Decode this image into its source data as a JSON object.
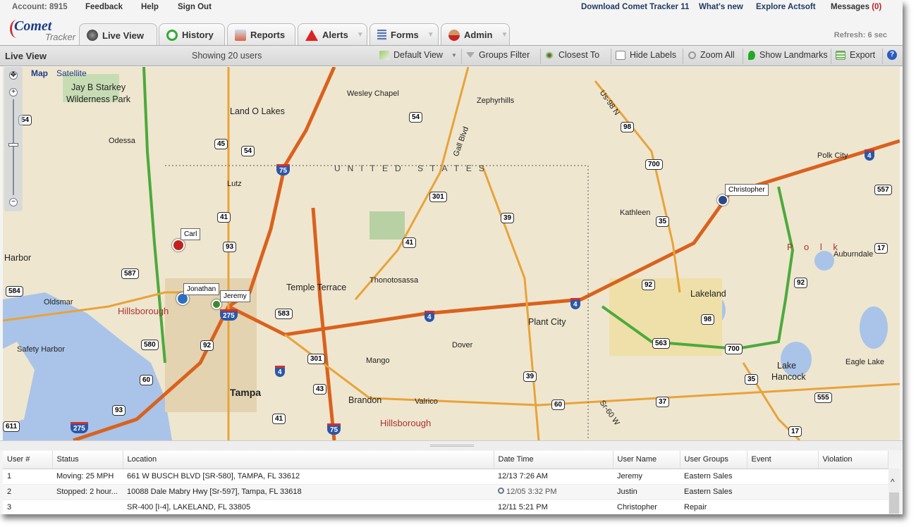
{
  "top_links": {
    "account": "Account: 8915",
    "feedback": "Feedback",
    "help": "Help",
    "sign_out": "Sign Out",
    "download": "Download Comet Tracker 11",
    "whats_new": "What's new",
    "explore": "Explore Actsoft",
    "messages": "Messages",
    "messages_count": "(0)"
  },
  "logo": {
    "brand": "Comet",
    "sub": "Tracker"
  },
  "tabs": [
    {
      "label": "Live View",
      "icon": "globe-icon"
    },
    {
      "label": "History",
      "icon": "clock-icon"
    },
    {
      "label": "Reports",
      "icon": "report-icon"
    },
    {
      "label": "Alerts",
      "icon": "warning-icon"
    },
    {
      "label": "Forms",
      "icon": "form-icon"
    },
    {
      "label": "Admin",
      "icon": "user-icon"
    }
  ],
  "dropdown_glyph": "▼",
  "refresh": "Refresh: 6 sec",
  "toolbar": {
    "title": "Live View",
    "showing": "Showing 20 users",
    "default_view": "Default View",
    "groups_filter": "Groups Filter",
    "closest_to": "Closest To",
    "hide_labels": "Hide Labels",
    "zoom_all": "Zoom All",
    "show_landmarks": "Show Landmarks",
    "export": "Export",
    "help": "?"
  },
  "map": {
    "map_type": "Map",
    "satellite": "Satellite",
    "country": "UNITED STATES",
    "places": [
      "Land O Lakes",
      "Wesley Chapel",
      "Zephyrhills",
      "Jay B Starkey",
      "Wilderness Park",
      "Odessa",
      "Lutz",
      "Temple Terrace",
      "Thonotosassa",
      "Plant City",
      "Lakeland",
      "Kathleen",
      "Polk City",
      "Auburndale",
      "Oldsmar",
      "Safety Harbor",
      "Mango",
      "Dover",
      "Brandon",
      "Valrico",
      "Tampa",
      "Lake",
      "Hancock",
      "Eagle Lake",
      "Harbor",
      "Gall Blvd",
      "Us-98 N",
      "Sr-60 W"
    ],
    "regions": [
      "Hillsborough",
      "Hillsborough",
      "P o l k"
    ],
    "shields": [
      "54",
      "54",
      "45",
      "54",
      "41",
      "93",
      "587",
      "580",
      "92",
      "60",
      "93",
      "583",
      "301",
      "43",
      "41",
      "301",
      "41",
      "39",
      "39",
      "60",
      "37",
      "35",
      "700",
      "98",
      "92",
      "98",
      "563",
      "700",
      "35",
      "555",
      "17",
      "17",
      "92",
      "557",
      "611",
      "584"
    ],
    "interstates": [
      "75",
      "275",
      "4",
      "4",
      "4",
      "275",
      "75",
      "4"
    ],
    "markers": [
      {
        "name": "Carl",
        "color": "#c0201e"
      },
      {
        "name": "Jonathan",
        "color": "#2c6fc0"
      },
      {
        "name": "Jeremy",
        "color": "#3b8a2e"
      },
      {
        "name": "Christopher",
        "color": "#2a4a8a"
      }
    ]
  },
  "grid": {
    "columns": [
      "User #",
      "Status",
      "Location",
      "Date Time",
      "User Name",
      "User Groups",
      "Event",
      "Violation"
    ],
    "rows": [
      [
        "1",
        "Moving: 25 MPH",
        "661 W BUSCH BLVD [SR-580], TAMPA, FL 33612",
        "12/13 7:26 AM",
        "Jeremy",
        "Eastern Sales",
        "",
        ""
      ],
      [
        "2",
        "Stopped: 2 hour...",
        "10088 Dale Mabry Hwy [Sr-597], Tampa, FL 33618",
        "12/05 3:32 PM",
        "Justin",
        "Eastern Sales",
        "",
        ""
      ],
      [
        "3",
        "",
        "SR-400 [I-4], LAKELAND, FL 33805",
        "12/11 5:21 PM",
        "Christopher",
        "Repair",
        "",
        ""
      ]
    ]
  },
  "scroll_up": "^"
}
